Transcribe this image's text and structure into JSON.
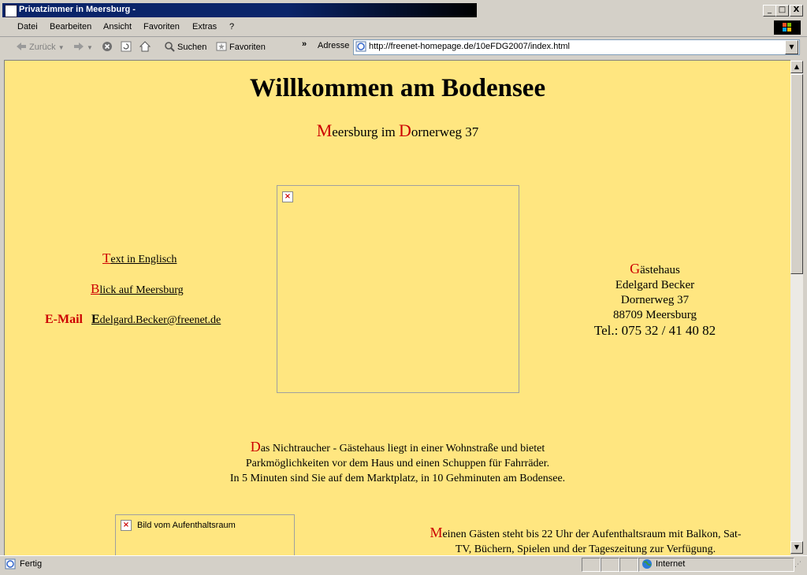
{
  "window": {
    "title": "Privatzimmer in Meersburg -",
    "min": "_",
    "max": "□",
    "close": "X"
  },
  "menu": [
    "Datei",
    "Bearbeiten",
    "Ansicht",
    "Favoriten",
    "Extras",
    "?"
  ],
  "toolbar": {
    "back": "Zurück",
    "search": "Suchen",
    "favorites": "Favoriten",
    "chevron": "»",
    "address_label": "Adresse"
  },
  "address": {
    "url": "http://freenet-homepage.de/10eFDG2007/index.html"
  },
  "page": {
    "heading": "Willkommen am Bodensee",
    "subtitle": {
      "m": "M",
      "m_rest": "eersburg im ",
      "d": "D",
      "d_rest": "ornerweg 37"
    },
    "links": {
      "english_initial": "T",
      "english_rest": "ext in Englisch",
      "view_initial": "B",
      "view_rest": "lick auf Meersburg",
      "email_label": "E-Mail",
      "email_initial": "E",
      "email_rest": "delgard.Becker@freenet.de"
    },
    "contact": {
      "g": "G",
      "g_rest": "ästehaus",
      "name": "Edelgard Becker",
      "street": "Dornerweg 37",
      "city": "88709 Meersburg",
      "tel": "Tel.: 075 32 / 41 40 82"
    },
    "description": {
      "d": "D",
      "line1": "as Nichtraucher - Gästehaus liegt in einer Wohnstraße und bietet",
      "line2": "Parkmöglichkeiten vor dem Haus und einen Schuppen für Fahrräder.",
      "line3": "In 5 Minuten sind Sie auf dem Marktplatz, in 10 Gehminuten am Bodensee."
    },
    "image2_alt": "Bild vom Aufenthaltsraum",
    "guests": {
      "m": "M",
      "line1": "einen Gästen steht bis 22 Uhr der Aufenthaltsraum mit Balkon, Sat-",
      "line2": "TV,  Büchern, Spielen und der Tageszeitung zur Verfügung."
    }
  },
  "status": {
    "text": "Fertig",
    "zone": "Internet"
  },
  "colors": {
    "background": "#ffe680",
    "accent_red": "#cc0000",
    "titlebar": "#0a246a"
  }
}
